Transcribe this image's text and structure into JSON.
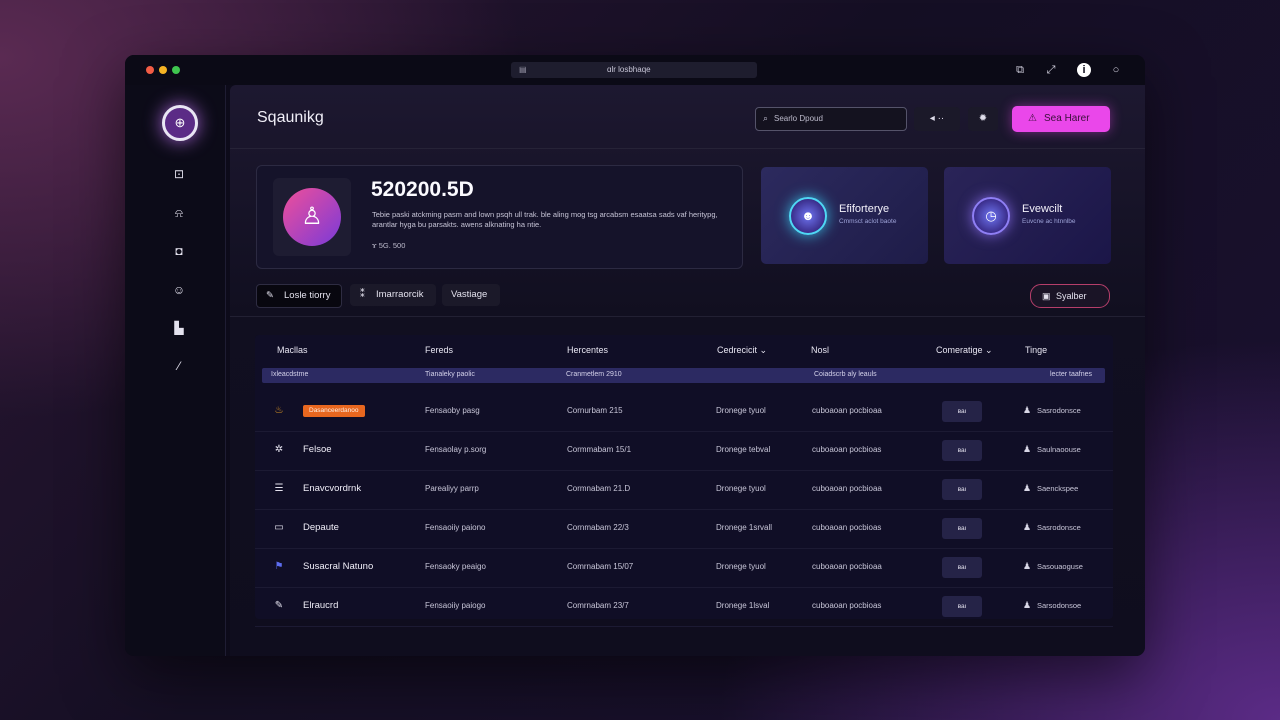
{
  "titlebar": {
    "url_text": "ɑlr losbhaqe",
    "icons": [
      "puzzle-icon",
      "pin-icon",
      "info-icon",
      "settings-icon"
    ]
  },
  "sidebar": {
    "logo_glyph": "⊕",
    "items": [
      {
        "icon": "inbox-icon",
        "glyph": "⊡"
      },
      {
        "icon": "bell-icon",
        "glyph": "⍾"
      },
      {
        "icon": "message-icon",
        "glyph": "◘"
      },
      {
        "icon": "robot-icon",
        "glyph": "☺"
      },
      {
        "icon": "folder-icon",
        "glyph": "▙"
      },
      {
        "icon": "wand-icon",
        "glyph": "⁄"
      }
    ]
  },
  "header": {
    "title": "Sqaunikg",
    "search_placeholder": "Searlo Dpoud",
    "share_label": "◂ ··",
    "settings_glyph": "✹",
    "primary_button_label": "Sea Harer",
    "primary_button_icon": "⚠"
  },
  "hero": {
    "value": "520200.5D",
    "description": "Tebie paski atckming pasm and lown psqh ull trak. ble aling mog tsg arcabsm esaatsa sads vaf heritypg, arantlar hyga bu parsakts. awens alknating ha ntie.",
    "meta": "ɤ 5G. 500",
    "icon_glyph": "♙"
  },
  "stats": [
    {
      "title": "Efiforterye",
      "subtitle": "Cmmsct aclot baote",
      "glyph": "☻"
    },
    {
      "title": "Evewcilt",
      "subtitle": "Euvcne ac htnnlbe",
      "glyph": "◷"
    }
  ],
  "tabs": [
    {
      "label": "Losle tiorry",
      "icon": "✎"
    },
    {
      "label": "Imarraorcik",
      "icon": "⁑"
    },
    {
      "label": "Vastiage",
      "icon": ""
    }
  ],
  "sort_button": {
    "label": "Syalber",
    "icon": "▣"
  },
  "table": {
    "headers": [
      "Macllas",
      "Fereds",
      "Hercentes",
      "Cedrecicit",
      "Nosl",
      "Comeratige",
      "Tinge"
    ],
    "group_row": {
      "c1": "Ixleacdstme",
      "c2": "Tianaleky paolic",
      "c3": "Cranmetlem 2910",
      "c5": "Coiadscrb aly leauls",
      "c7": "lecter taafnes"
    },
    "rows": [
      {
        "icon": "fire-icon",
        "glyph": "♨",
        "name": "Dasanceerdanoo",
        "badge": true,
        "col2": "Fensaoby pasg",
        "col3": "Cornurbam 215",
        "col4": "Dronege tyuol",
        "col5": "cuboaoan pocbioaa",
        "action": "ʙaı",
        "user": "Sasrodonsce"
      },
      {
        "icon": "gear-icon",
        "glyph": "✲",
        "name": "Felsoe",
        "badge": false,
        "col2": "Fensaolay p.sorg",
        "col3": "Cormmabam 15/1",
        "col4": "Dronege tebval",
        "col5": "cuboaoan pocbioas",
        "action": "ʙaı",
        "user": "Saulnaoouse"
      },
      {
        "icon": "list-icon",
        "glyph": "☰",
        "name": "Enavcvordrnk",
        "badge": false,
        "col2": "Parealiyy parrp",
        "col3": "Cormnabam 21.D",
        "col4": "Dronege tyuol",
        "col5": "cuboaoan pocbioaa",
        "action": "ʙaı",
        "user": "Saenckspee"
      },
      {
        "icon": "monitor-icon",
        "glyph": "▭",
        "name": "Depaute",
        "badge": false,
        "col2": "Fensaoiiy paiono",
        "col3": "Cornmabam 22/3",
        "col4": "Dronege 1srvall",
        "col5": "cuboaoan pocbioas",
        "action": "ʙaı",
        "user": "Sasrodonsce"
      },
      {
        "icon": "flag-icon",
        "glyph": "⚑",
        "name": "Susacral Natuno",
        "badge": false,
        "col2": "Fensaoky peaigo",
        "col3": "Comrnabam 15/07",
        "col4": "Dronege tyuol",
        "col5": "cuboaoan pocbioaa",
        "action": "ʙaı",
        "user": "Sasouaoguse"
      },
      {
        "icon": "pencil-icon",
        "glyph": "✎",
        "name": "Elraucrd",
        "badge": false,
        "col2": "Fensaoiiy paiogo",
        "col3": "Comrnabam 23/7",
        "col4": "Dronege 1lsval",
        "col5": "cuboaoan pocbioas",
        "action": "ʙaı",
        "user": "Sarsodonsoe"
      }
    ]
  },
  "colors": {
    "accent": "#ea47ea",
    "badge": "#e8671f",
    "window_bg": "#0d0b1a",
    "table_bg": "#100e26"
  }
}
